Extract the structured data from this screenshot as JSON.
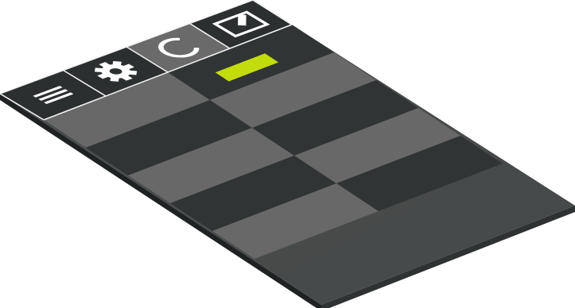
{
  "toolbar": {
    "buttons": [
      {
        "name": "menu-button",
        "icon": "menu-icon",
        "state": "normal"
      },
      {
        "name": "settings-button",
        "icon": "gear-icon",
        "state": "normal"
      },
      {
        "name": "refresh-button",
        "icon": "refresh-icon",
        "state": "active"
      },
      {
        "name": "edit-button",
        "icon": "edit-icon",
        "state": "normal"
      }
    ]
  },
  "grid": {
    "rows": 5,
    "cols": 2,
    "selected_cell": {
      "row": 0,
      "col": 1
    },
    "highlight_color": "#c2dc0e"
  },
  "colors": {
    "toolbar": "#2c2f30",
    "toolbar_active": "#6a6a6a",
    "toolbar_divider": "#f2f2f2",
    "row_light": "#686868",
    "row_dark": "#303434",
    "board": "#484b4b",
    "edge_left": "#1f2223",
    "edge_right": "#2f3233",
    "accent": "#c2dc0e"
  }
}
